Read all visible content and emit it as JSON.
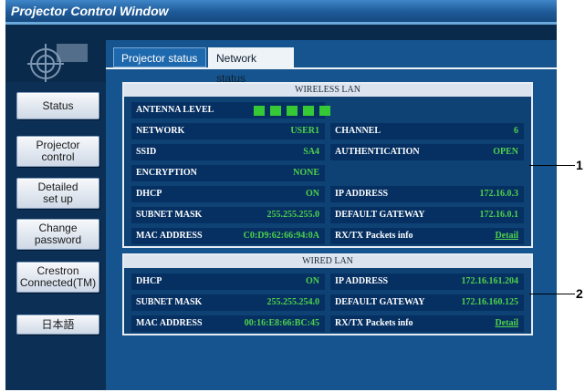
{
  "window_title": "Projector Control Window",
  "tabs": {
    "projector_status": "Projector status",
    "network_status": "Network status"
  },
  "nav": [
    {
      "label": "Status"
    },
    {
      "label": "Projector\ncontrol"
    },
    {
      "label": "Detailed\nset up"
    },
    {
      "label": "Change\npassword"
    },
    {
      "label": "Crestron\nConnected(TM)"
    },
    {
      "label": "日本語"
    }
  ],
  "wireless": {
    "header": "WIRELESS LAN",
    "antenna_label": "ANTENNA LEVEL",
    "antenna_level": 5,
    "antenna_color": "#36c936",
    "network_label": "NETWORK",
    "network_value": "USER1",
    "channel_label": "CHANNEL",
    "channel_value": "6",
    "ssid_label": "SSID",
    "ssid_value": "SA4",
    "auth_label": "AUTHENTICATION",
    "auth_value": "OPEN",
    "encryption_label": "ENCRYPTION",
    "encryption_value": "NONE",
    "dhcp_label": "DHCP",
    "dhcp_value": "ON",
    "ip_label": "IP ADDRESS",
    "ip_value": "172.16.0.3",
    "subnet_label": "SUBNET MASK",
    "subnet_value": "255.255.255.0",
    "gateway_label": "DEFAULT GATEWAY",
    "gateway_value": "172.16.0.1",
    "mac_label": "MAC ADDRESS",
    "mac_value": "C0:D9:62:66:94:0A",
    "packets_label": "RX/TX Packets info",
    "packets_link": "Detail"
  },
  "wired": {
    "header": "WIRED LAN",
    "dhcp_label": "DHCP",
    "dhcp_value": "ON",
    "ip_label": "IP ADDRESS",
    "ip_value": "172.16.161.204",
    "subnet_label": "SUBNET MASK",
    "subnet_value": "255.255.254.0",
    "gateway_label": "DEFAULT GATEWAY",
    "gateway_value": "172.16.160.125",
    "mac_label": "MAC ADDRESS",
    "mac_value": "00:16:E8:66:BC:45",
    "packets_label": "RX/TX Packets info",
    "packets_link": "Detail"
  },
  "callouts": [
    "1",
    "2"
  ],
  "colors": {
    "value_green": "#4fd14b",
    "panel_blue": "#16548f",
    "row_navy": "#063062"
  }
}
